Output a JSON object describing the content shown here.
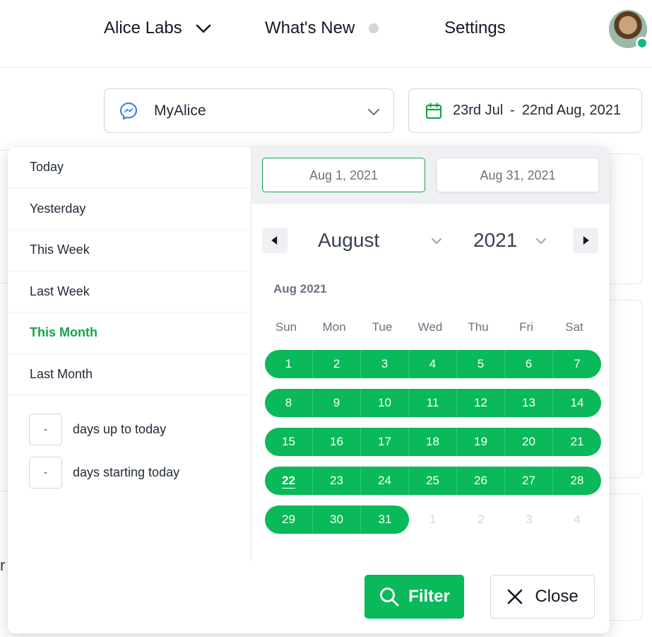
{
  "topnav": {
    "org_name": "Alice Labs",
    "whats_new": "What's New",
    "settings": "Settings"
  },
  "toolbar": {
    "channel_name": "MyAlice",
    "date_range_start": "23rd Jul",
    "date_range_sep": "-",
    "date_range_end": "22nd Aug, 2021"
  },
  "background": {
    "peek_text": "r"
  },
  "datepicker": {
    "presets": [
      {
        "label": "Today",
        "active": false
      },
      {
        "label": "Yesterday",
        "active": false
      },
      {
        "label": "This Week",
        "active": false
      },
      {
        "label": "Last Week",
        "active": false
      },
      {
        "label": "This Month",
        "active": true
      },
      {
        "label": "Last Month",
        "active": false
      }
    ],
    "custom": [
      {
        "value": "-",
        "label": "days up to today"
      },
      {
        "value": "-",
        "label": "days starting today"
      }
    ],
    "start_date": "Aug 1, 2021",
    "end_date": "Aug 31, 2021",
    "month": "August",
    "year": "2021",
    "month_title": "Aug 2021",
    "weekdays": [
      "Sun",
      "Mon",
      "Tue",
      "Wed",
      "Thu",
      "Fri",
      "Sat"
    ],
    "weeks": [
      [
        "1",
        "2",
        "3",
        "4",
        "5",
        "6",
        "7"
      ],
      [
        "8",
        "9",
        "10",
        "11",
        "12",
        "13",
        "14"
      ],
      [
        "15",
        "16",
        "17",
        "18",
        "19",
        "20",
        "21"
      ],
      [
        "22",
        "23",
        "24",
        "25",
        "26",
        "27",
        "28"
      ],
      [
        "29",
        "30",
        "31",
        "1",
        "2",
        "3",
        "4"
      ]
    ],
    "selected_count_last_week": 3,
    "today": "22",
    "filter_label": "Filter",
    "close_label": "Close",
    "accent_color": "#09b95a"
  }
}
